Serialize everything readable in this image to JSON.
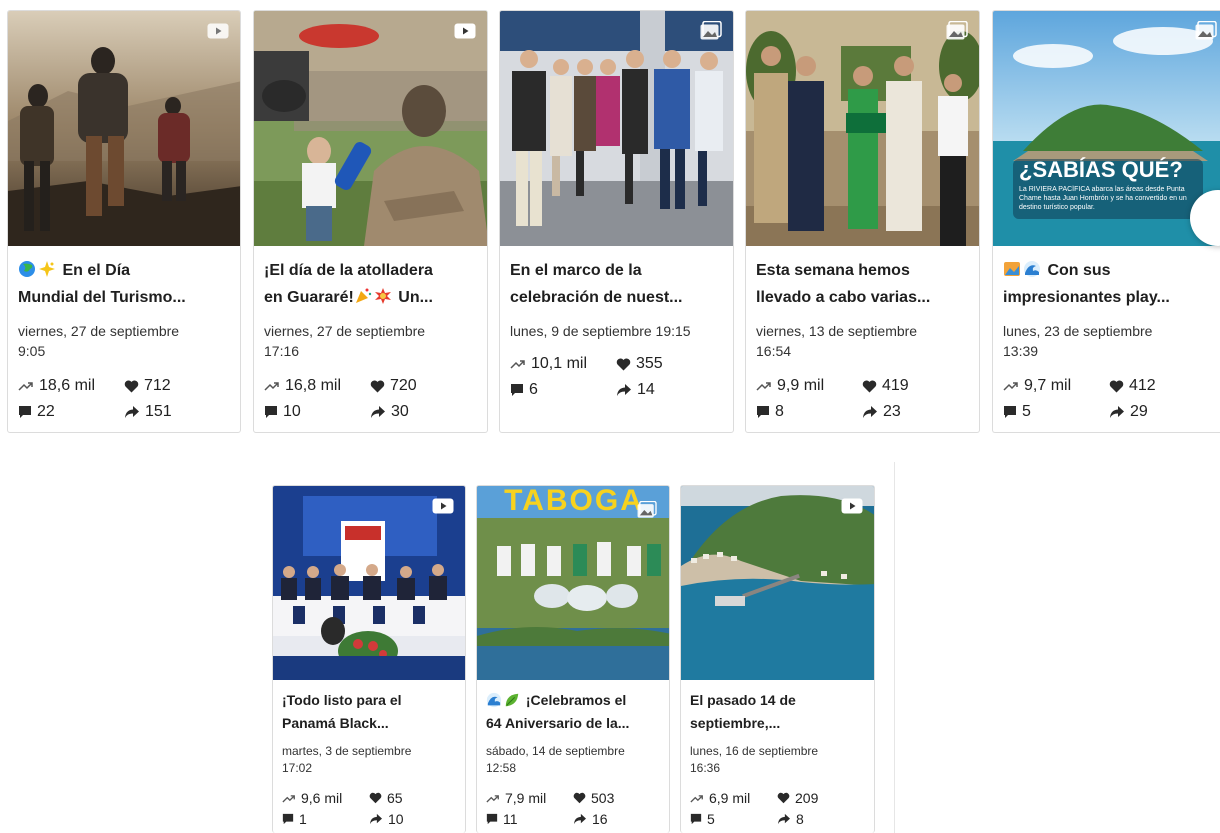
{
  "posts": [
    {
      "title_line1": "En el Día",
      "title_line2": "Mundial del Turismo...",
      "date": "viernes, 27 de septiembre",
      "time": "9:05",
      "reach": "18,6 mil",
      "likes": "712",
      "comments": "22",
      "shares": "151",
      "media": "video"
    },
    {
      "title_line1": "¡El día de la atolladera",
      "title_line2": "en Guararé! Un...",
      "date": "viernes, 27 de septiembre",
      "time": "17:16",
      "reach": "16,8 mil",
      "likes": "720",
      "comments": "10",
      "shares": "30",
      "media": "video"
    },
    {
      "title_line1": "En el marco de la",
      "title_line2": "celebración de nuest...",
      "date": "lunes, 9 de septiembre 19:15",
      "time": "",
      "reach": "10,1 mil",
      "likes": "355",
      "comments": "6",
      "shares": "14",
      "media": "image"
    },
    {
      "title_line1": "Esta semana hemos",
      "title_line2": "llevado a cabo varias...",
      "date": "viernes, 13 de septiembre",
      "time": "16:54",
      "reach": "9,9 mil",
      "likes": "419",
      "comments": "8",
      "shares": "23",
      "media": "image"
    },
    {
      "title_line1": "Con sus",
      "title_line2": "impresionantes play...",
      "date": "lunes, 23 de septiembre",
      "time": "13:39",
      "reach": "9,7 mil",
      "likes": "412",
      "comments": "5",
      "shares": "29",
      "media": "image",
      "overlay_title": "¿SABÍAS QUÉ?",
      "overlay_text": "La RIVIERA PACÍFICA abarca las áreas desde Punta Chame hasta Juan Hombrón y se ha convertido en un destino turístico popular."
    },
    {
      "title_line1": "¡Todo listo para el",
      "title_line2": "Panamá Black...",
      "date": "martes, 3 de septiembre",
      "time": "17:02",
      "reach": "9,6 mil",
      "likes": "65",
      "comments": "1",
      "shares": "10",
      "media": "video"
    },
    {
      "title_line1": "¡Celebramos el",
      "title_line2": "64 Aniversario de la...",
      "date": "sábado, 14 de septiembre",
      "time": "12:58",
      "reach": "7,9 mil",
      "likes": "503",
      "comments": "11",
      "shares": "16",
      "media": "image",
      "overlay_title": "TABOGA"
    },
    {
      "title_line1": "El pasado 14 de",
      "title_line2": "septiembre,...",
      "date": "lunes, 16 de septiembre",
      "time": "16:36",
      "reach": "6,9 mil",
      "likes": "209",
      "comments": "5",
      "shares": "8",
      "media": "video"
    }
  ],
  "colors": {
    "accent": "#1877f2",
    "text": "#1f1f1f",
    "border": "#dcdcdc"
  }
}
